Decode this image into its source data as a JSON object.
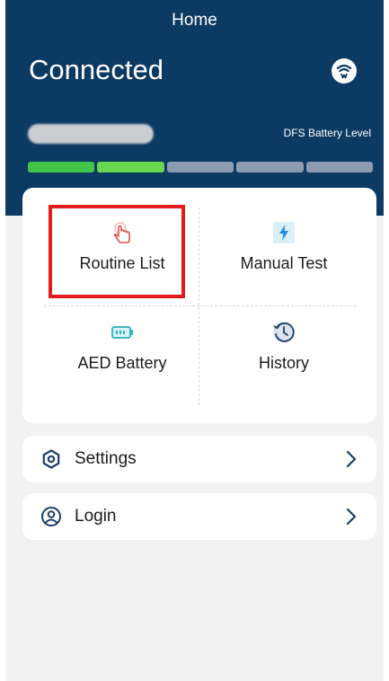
{
  "header": {
    "title": "Home",
    "status": "Connected",
    "battery_label": "DFS Battery Level",
    "battery_segments_total": 5,
    "battery_segments_filled": 2
  },
  "menu": {
    "tiles": [
      {
        "label": "Routine List",
        "icon": "tap-hand-icon"
      },
      {
        "label": "Manual Test",
        "icon": "lightning-bolt-icon"
      },
      {
        "label": "AED Battery",
        "icon": "battery-icon"
      },
      {
        "label": "History",
        "icon": "history-clock-icon"
      }
    ]
  },
  "list": {
    "settings_label": "Settings",
    "login_label": "Login"
  },
  "colors": {
    "header_bg": "#0b3a63",
    "battery_on": "#41c448",
    "battery_off": "#8d9bb0",
    "highlight": "#e41b1b",
    "icon_red": "#d9534f",
    "icon_teal": "#2bb3c0",
    "icon_navy": "#1d3f66"
  }
}
